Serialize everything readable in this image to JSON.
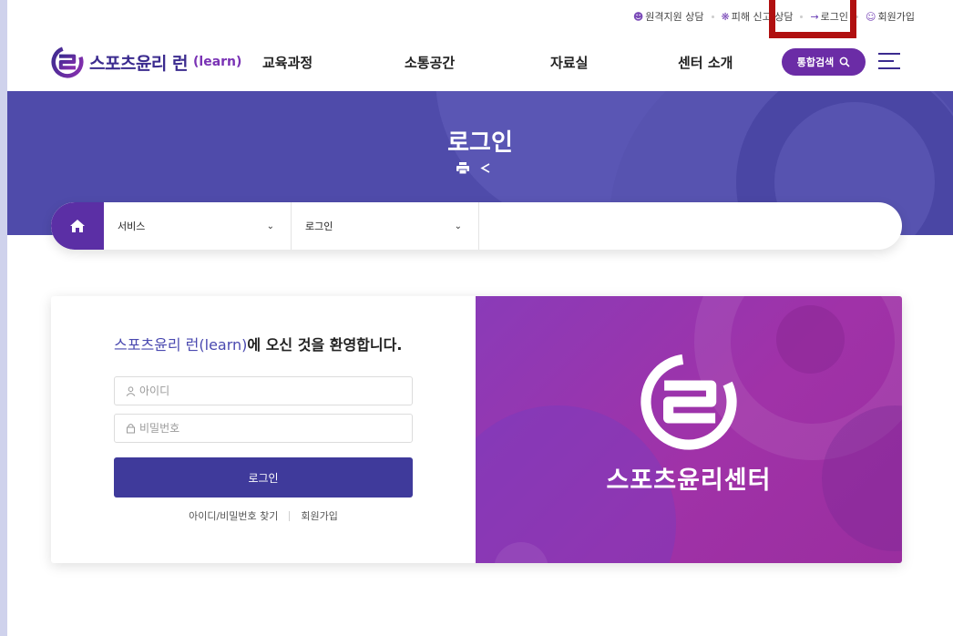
{
  "colors": {
    "brand_purple": "#5b2fa5",
    "banner_blue": "#4f4baa",
    "login_button": "#3f3a9b",
    "promo_panel": "#9a33a8",
    "highlight_red": "#b01010"
  },
  "utility_bar": {
    "remote_support": "원격지원 상담",
    "damage_report": "피해 신고 상담",
    "login": "로그인",
    "signup": "회원가입"
  },
  "header": {
    "logo_text": "스포츠윤리 런",
    "logo_sub": "(learn)",
    "nav": [
      "교육과정",
      "소통공간",
      "자료실",
      "센터 소개"
    ],
    "search_label": "통합검색"
  },
  "banner": {
    "title": "로그인"
  },
  "breadcrumb": {
    "level1": "서비스",
    "level2": "로그인"
  },
  "login_card": {
    "welcome_accent": "스포츠윤리 런(learn)",
    "welcome_rest": "에 오신 것을 환영합니다.",
    "id_placeholder": "아이디",
    "pw_placeholder": "비밀번호",
    "login_button": "로그인",
    "find_link": "아이디/비밀번호 찾기",
    "signup_link": "회원가입"
  },
  "promo": {
    "title": "스포츠윤리센터"
  },
  "icons": {
    "remote_support": "person-headset-icon",
    "damage_report": "alert-icon",
    "login": "login-arrow-icon",
    "signup": "person-icon",
    "search": "search-icon",
    "menu": "hamburger-icon",
    "print": "print-icon",
    "share": "share-icon",
    "home": "home-icon"
  }
}
